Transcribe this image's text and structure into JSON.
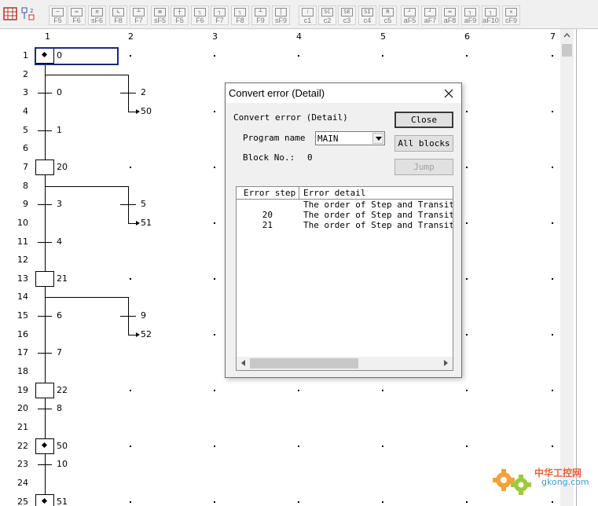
{
  "toolbar": {
    "buttons": [
      {
        "label": "F5",
        "glyph": "─"
      },
      {
        "label": "F6",
        "glyph": "═"
      },
      {
        "label": "sF6",
        "glyph": "≡"
      },
      {
        "label": "F8",
        "glyph": "↳"
      },
      {
        "label": "F7",
        "glyph": "┴"
      },
      {
        "label": "sF5",
        "glyph": "⊠"
      },
      {
        "label": "F5",
        "glyph": "┼"
      },
      {
        "label": "F6",
        "glyph": "┐"
      },
      {
        "label": "F7",
        "glyph": "┐"
      },
      {
        "label": "F8",
        "glyph": "┐"
      },
      {
        "label": "F9",
        "glyph": "┴"
      },
      {
        "label": "sF9",
        "glyph": "│"
      },
      {
        "label": "c1",
        "glyph": "⁞"
      },
      {
        "label": "c2",
        "glyph": "SC"
      },
      {
        "label": "c3",
        "glyph": "SE"
      },
      {
        "label": "c4",
        "glyph": "SI"
      },
      {
        "label": "c5",
        "glyph": "R"
      },
      {
        "label": "aF5",
        "glyph": "┘"
      },
      {
        "label": "aF7",
        "glyph": "┘"
      },
      {
        "label": "aF8",
        "glyph": "═"
      },
      {
        "label": "aF9",
        "glyph": "┐"
      },
      {
        "label": "aF10",
        "glyph": "┐"
      },
      {
        "label": "cF9",
        "glyph": "✕"
      }
    ]
  },
  "ladder": {
    "columns": [
      "1",
      "2",
      "3",
      "4",
      "5",
      "6",
      "7"
    ],
    "rows": [
      "1",
      "2",
      "3",
      "4",
      "5",
      "6",
      "7",
      "8",
      "9",
      "10",
      "11",
      "12",
      "13",
      "14",
      "15",
      "16",
      "17",
      "18",
      "19",
      "20",
      "21",
      "22",
      "23",
      "24",
      "25"
    ],
    "labels": [
      {
        "row": 1,
        "col": 1,
        "text": "0"
      },
      {
        "row": 3,
        "col": 1,
        "text": "0"
      },
      {
        "row": 3,
        "col": 2,
        "text": "2"
      },
      {
        "row": 4,
        "col": 2,
        "text": "50"
      },
      {
        "row": 5,
        "col": 1,
        "text": "1"
      },
      {
        "row": 7,
        "col": 1,
        "text": "20"
      },
      {
        "row": 9,
        "col": 1,
        "text": "3"
      },
      {
        "row": 9,
        "col": 2,
        "text": "5"
      },
      {
        "row": 10,
        "col": 2,
        "text": "51"
      },
      {
        "row": 11,
        "col": 1,
        "text": "4"
      },
      {
        "row": 13,
        "col": 1,
        "text": "21"
      },
      {
        "row": 15,
        "col": 1,
        "text": "6"
      },
      {
        "row": 15,
        "col": 2,
        "text": "9"
      },
      {
        "row": 16,
        "col": 2,
        "text": "52"
      },
      {
        "row": 17,
        "col": 1,
        "text": "7"
      },
      {
        "row": 19,
        "col": 1,
        "text": "22"
      },
      {
        "row": 20,
        "col": 1,
        "text": "8"
      },
      {
        "row": 22,
        "col": 1,
        "text": "50"
      },
      {
        "row": 23,
        "col": 1,
        "text": "10"
      },
      {
        "row": 25,
        "col": 1,
        "text": "51"
      }
    ]
  },
  "dialog": {
    "title": "Convert error (Detail)",
    "heading": "Convert error (Detail)",
    "program_name_label": "Program name",
    "program_name_value": "MAIN",
    "block_no_label": "Block No.:",
    "block_no_value": "0",
    "close_label": "Close",
    "all_blocks_label": "All blocks",
    "jump_label": "Jump",
    "table": {
      "headers": [
        "Error step",
        "Error detail"
      ],
      "rows": [
        {
          "step": "",
          "detail": "The order of Step and Transition"
        },
        {
          "step": "20",
          "detail": "The order of Step and Transition"
        },
        {
          "step": "21",
          "detail": "The order of Step and Transition"
        }
      ]
    }
  },
  "watermark": {
    "cn": "中华工控网",
    "url": "gkong.com"
  }
}
